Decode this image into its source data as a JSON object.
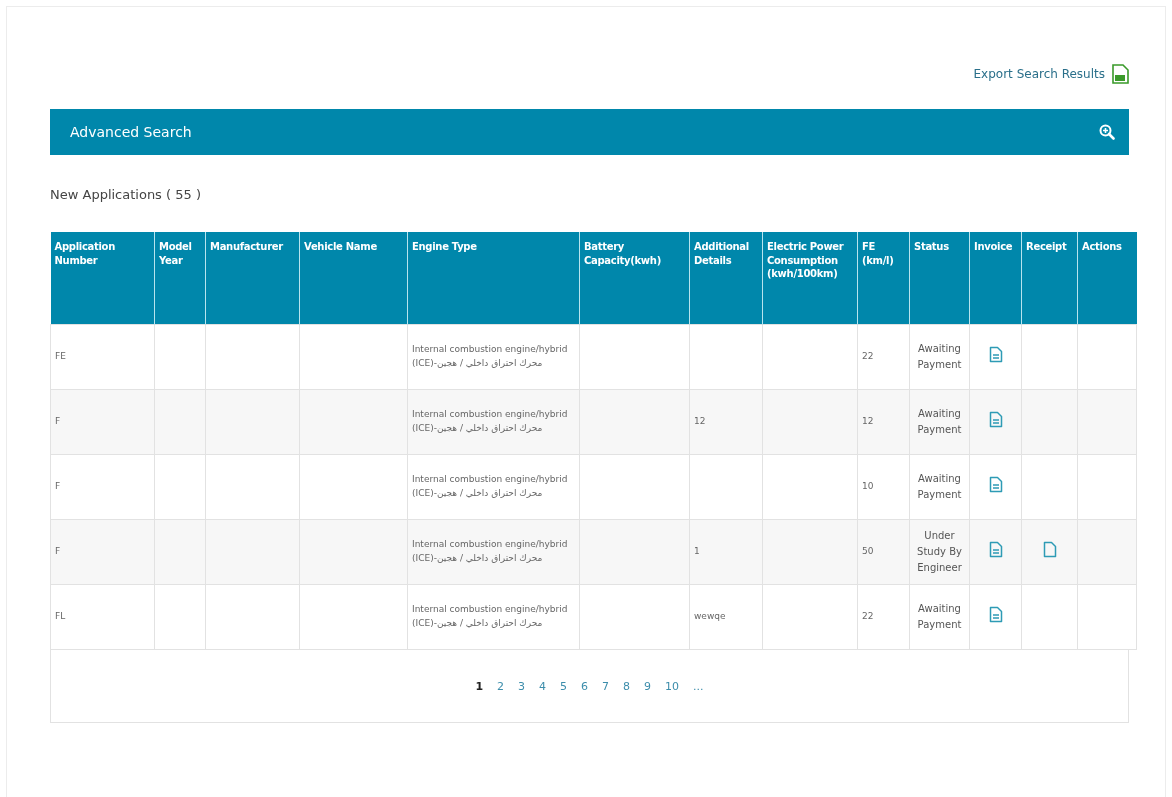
{
  "export_link": {
    "label": "Export Search Results"
  },
  "advanced_search": {
    "title": "Advanced Search"
  },
  "section_title": "New Applications ( 55 )",
  "table": {
    "columns": [
      "Application Number",
      "Model Year",
      "Manufacturer",
      "Vehicle Name",
      "Engine Type",
      "Battery Capacity(kwh)",
      "Additional Details",
      "Electric Power Consumption (kwh/100km)",
      "FE (km/l)",
      "Status",
      "Invoice",
      "Receipt",
      "Actions"
    ],
    "rows": [
      {
        "application_number": "FE",
        "engine_type": "Internal combustion engine/hybrid (ICE)-محرك احتراق داخلي / هجين",
        "additional_details": "",
        "fe": "22",
        "status": "Awaiting Payment",
        "invoice": true,
        "receipt": false
      },
      {
        "application_number": "F",
        "engine_type": "Internal combustion engine/hybrid (ICE)-محرك احتراق داخلي / هجين",
        "additional_details": "12",
        "fe": "12",
        "status": "Awaiting Payment",
        "invoice": true,
        "receipt": false
      },
      {
        "application_number": "F",
        "engine_type": "Internal combustion engine/hybrid (ICE)-محرك احتراق داخلي / هجين",
        "additional_details": "",
        "fe": "10",
        "status": "Awaiting Payment",
        "invoice": true,
        "receipt": false
      },
      {
        "application_number": "F",
        "engine_type": "Internal combustion engine/hybrid (ICE)-محرك احتراق داخلي / هجين",
        "additional_details": "1",
        "fe": "50",
        "status": "Under Study By Engineer",
        "invoice": true,
        "receipt": true
      },
      {
        "application_number": "FL",
        "engine_type": "Internal combustion engine/hybrid (ICE)-محرك احتراق داخلي / هجين",
        "additional_details": "wewqe",
        "fe": "22",
        "status": "Awaiting Payment",
        "invoice": true,
        "receipt": false
      }
    ]
  },
  "pagination": [
    {
      "label": "1",
      "selected": true
    },
    {
      "label": "2",
      "selected": false
    },
    {
      "label": "3",
      "selected": false
    },
    {
      "label": "4",
      "selected": false
    },
    {
      "label": "5",
      "selected": false
    },
    {
      "label": "6",
      "selected": false
    },
    {
      "label": "7",
      "selected": false
    },
    {
      "label": "8",
      "selected": false
    },
    {
      "label": "9",
      "selected": false
    },
    {
      "label": "10",
      "selected": false
    },
    {
      "label": "...",
      "selected": false
    }
  ]
}
